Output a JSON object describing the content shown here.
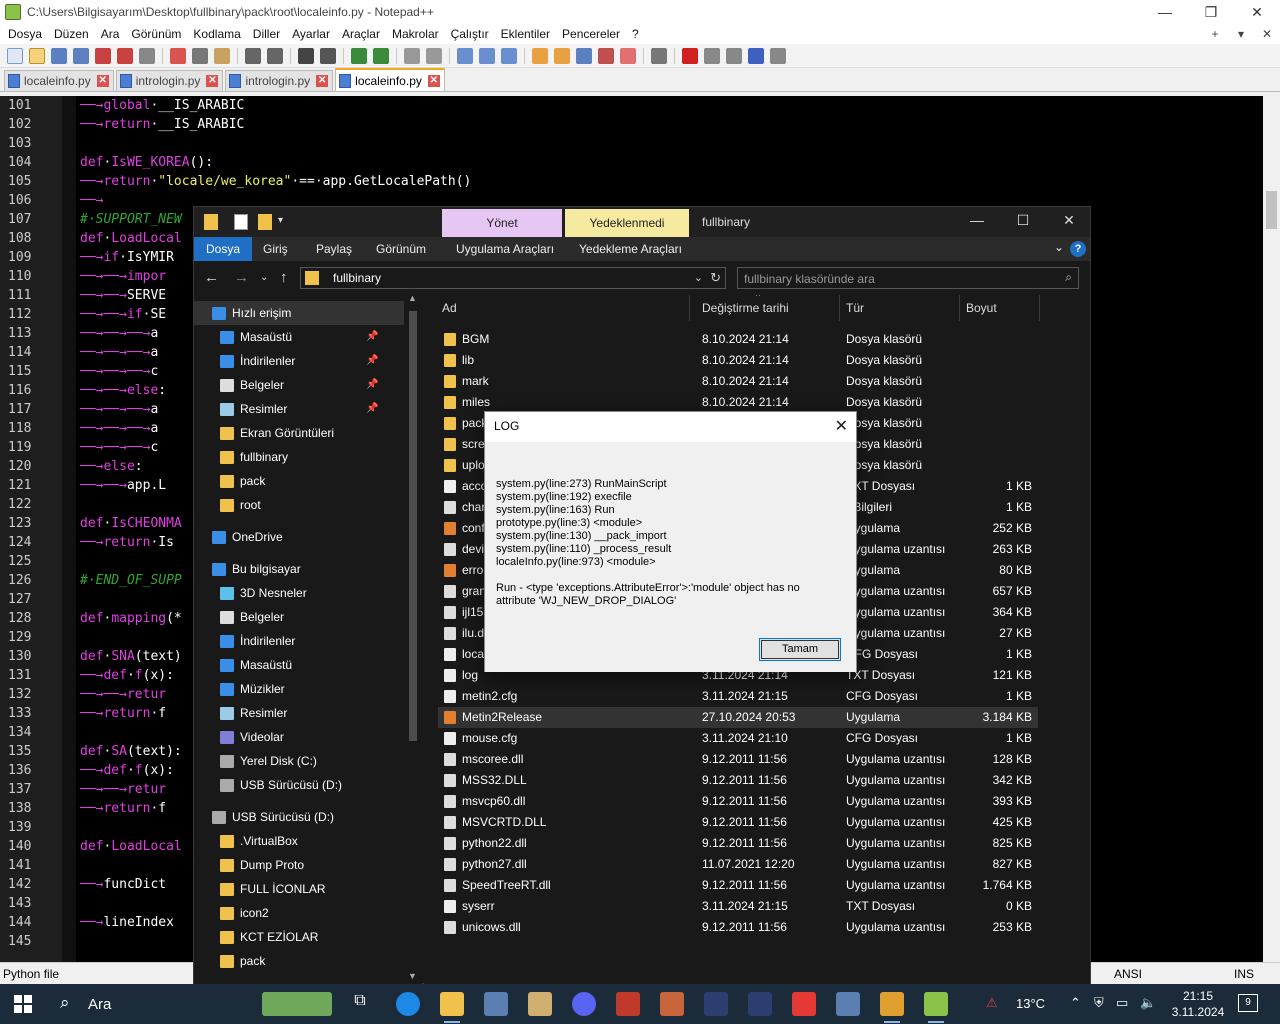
{
  "npp": {
    "title": "C:\\Users\\Bilgisayarım\\Desktop\\fullbinary\\pack\\root\\localeinfo.py - Notepad++",
    "menu": [
      "Dosya",
      "Düzen",
      "Ara",
      "Görünüm",
      "Kodlama",
      "Diller",
      "Ayarlar",
      "Araçlar",
      "Makrolar",
      "Çalıştır",
      "Eklentiler",
      "Pencereler",
      "?"
    ],
    "menu_right": [
      "+",
      "▾",
      "✕"
    ],
    "tabs": [
      {
        "label": "localeinfo.py"
      },
      {
        "label": "intrologin.py"
      },
      {
        "label": "intrologin.py"
      },
      {
        "label": "localeinfo.py"
      }
    ],
    "line_numbers": [
      "101",
      "102",
      "103",
      "104",
      "105",
      "106",
      "107",
      "108",
      "109",
      "110",
      "111",
      "112",
      "113",
      "114",
      "115",
      "116",
      "117",
      "118",
      "119",
      "120",
      "121",
      "122",
      "123",
      "124",
      "125",
      "126",
      "127",
      "128",
      "129",
      "130",
      "131",
      "132",
      "133",
      "134",
      "135",
      "136",
      "137",
      "138",
      "139",
      "140",
      "141",
      "142",
      "143",
      "144",
      "145"
    ],
    "status": {
      "lang": "Python file",
      "eol": "",
      "encoding": "ANSI",
      "mode": "INS"
    }
  },
  "explorer": {
    "title": "fullbinary",
    "tab_manage": "Yönet",
    "tab_bin": "Yedeklenmedi",
    "ribbon": [
      "Dosya",
      "Giriş",
      "Paylaş",
      "Görünüm",
      "Uygulama Araçları",
      "Yedekleme Araçları"
    ],
    "address": "fullbinary",
    "search_placeholder": "fullbinary klasöründe ara",
    "nav": [
      {
        "label": "Hızlı erişim",
        "icon": "star-icon"
      },
      {
        "label": "Masaüstü",
        "icon": "desktop-icon"
      },
      {
        "label": "İndirilenler",
        "icon": "download-icon"
      },
      {
        "label": "Belgeler",
        "icon": "documents-icon"
      },
      {
        "label": "Resimler",
        "icon": "pictures-icon"
      },
      {
        "label": "Ekran Görüntüleri",
        "icon": "folder-icon"
      },
      {
        "label": "fullbinary",
        "icon": "folder-icon"
      },
      {
        "label": "pack",
        "icon": "folder-icon"
      },
      {
        "label": "root",
        "icon": "folder-icon"
      },
      {
        "label": "OneDrive",
        "icon": "cloud-icon"
      },
      {
        "label": "Bu bilgisayar",
        "icon": "computer-icon"
      },
      {
        "label": "3D Nesneler",
        "icon": "cube-icon"
      },
      {
        "label": "Belgeler",
        "icon": "documents-icon"
      },
      {
        "label": "İndirilenler",
        "icon": "download-icon"
      },
      {
        "label": "Masaüstü",
        "icon": "desktop-icon"
      },
      {
        "label": "Müzikler",
        "icon": "music-icon"
      },
      {
        "label": "Resimler",
        "icon": "pictures-icon"
      },
      {
        "label": "Videolar",
        "icon": "video-icon"
      },
      {
        "label": "Yerel Disk (C:)",
        "icon": "drive-icon"
      },
      {
        "label": "USB Sürücüsü (D:)",
        "icon": "usb-drive-icon"
      },
      {
        "label": "USB Sürücüsü (D:)",
        "icon": "usb-drive-icon"
      },
      {
        "label": ".VirtualBox",
        "icon": "folder-icon"
      },
      {
        "label": "Dump Proto",
        "icon": "folder-icon"
      },
      {
        "label": "FULL İCONLAR",
        "icon": "folder-icon"
      },
      {
        "label": "icon2",
        "icon": "folder-icon"
      },
      {
        "label": "KCT EZİOLAR",
        "icon": "folder-icon"
      },
      {
        "label": "pack",
        "icon": "folder-icon"
      }
    ],
    "columns": [
      "Ad",
      "Değiştirme tarihi",
      "Tür",
      "Boyut"
    ],
    "files": [
      {
        "name": "BGM",
        "date": "8.10.2024 21:14",
        "type": "Dosya klasörü",
        "size": ""
      },
      {
        "name": "lib",
        "date": "8.10.2024 21:14",
        "type": "Dosya klasörü",
        "size": ""
      },
      {
        "name": "mark",
        "date": "8.10.2024 21:14",
        "type": "Dosya klasörü",
        "size": ""
      },
      {
        "name": "miles",
        "date": "8.10.2024 21:14",
        "type": "Dosya klasörü",
        "size": ""
      },
      {
        "name": "pack",
        "date": "",
        "type": "Dosya klasörü",
        "size": ""
      },
      {
        "name": "screenshot",
        "date": "",
        "type": "Dosya klasörü",
        "size": ""
      },
      {
        "name": "upload",
        "date": "",
        "type": "Dosya klasörü",
        "size": ""
      },
      {
        "name": "account",
        "date": "",
        "type": "TXT Dosyası",
        "size": "1 KB"
      },
      {
        "name": "channel",
        "date": "",
        "type": "r Bilgileri",
        "size": "1 KB"
      },
      {
        "name": "config",
        "date": "",
        "type": "Uygulama",
        "size": "252 KB"
      },
      {
        "name": "devil",
        "date": "",
        "type": "Uygulama uzantısı",
        "size": "263 KB"
      },
      {
        "name": "error",
        "date": "",
        "type": "Uygulama",
        "size": "80 KB"
      },
      {
        "name": "granny2",
        "date": "",
        "type": "Uygulama uzantısı",
        "size": "657 KB"
      },
      {
        "name": "ijl15",
        "date": "",
        "type": "Uygulama uzantısı",
        "size": "364 KB"
      },
      {
        "name": "ilu.dll",
        "date": "",
        "type": "Uygulama uzantısı",
        "size": "27 KB"
      },
      {
        "name": "locale",
        "date": "",
        "type": "CFG Dosyası",
        "size": "1 KB"
      },
      {
        "name": "log",
        "date": "3.11.2024 21:14",
        "type": "TXT Dosyası",
        "size": "121 KB"
      },
      {
        "name": "metin2.cfg",
        "date": "3.11.2024 21:15",
        "type": "CFG Dosyası",
        "size": "1 KB"
      },
      {
        "name": "Metin2Release",
        "date": "27.10.2024 20:53",
        "type": "Uygulama",
        "size": "3.184 KB"
      },
      {
        "name": "mouse.cfg",
        "date": "3.11.2024 21:10",
        "type": "CFG Dosyası",
        "size": "1 KB"
      },
      {
        "name": "mscoree.dll",
        "date": "9.12.2011 11:56",
        "type": "Uygulama uzantısı",
        "size": "128 KB"
      },
      {
        "name": "MSS32.DLL",
        "date": "9.12.2011 11:56",
        "type": "Uygulama uzantısı",
        "size": "342 KB"
      },
      {
        "name": "msvcp60.dll",
        "date": "9.12.2011 11:56",
        "type": "Uygulama uzantısı",
        "size": "393 KB"
      },
      {
        "name": "MSVCRTD.DLL",
        "date": "9.12.2011 11:56",
        "type": "Uygulama uzantısı",
        "size": "425 KB"
      },
      {
        "name": "python22.dll",
        "date": "9.12.2011 11:56",
        "type": "Uygulama uzantısı",
        "size": "825 KB"
      },
      {
        "name": "python27.dll",
        "date": "11.07.2021 12:20",
        "type": "Uygulama uzantısı",
        "size": "827 KB"
      },
      {
        "name": "SpeedTreeRT.dll",
        "date": "9.12.2011 11:56",
        "type": "Uygulama uzantısı",
        "size": "1.764 KB"
      },
      {
        "name": "syserr",
        "date": "3.11.2024 21:15",
        "type": "TXT Dosyası",
        "size": "0 KB"
      },
      {
        "name": "unicows.dll",
        "date": "9.12.2011 11:56",
        "type": "Uygulama uzantısı",
        "size": "253 KB"
      }
    ]
  },
  "log_dialog": {
    "title": "LOG",
    "lines": [
      "system.py(line:273) RunMainScript",
      "system.py(line:192) execfile",
      "system.py(line:163) Run",
      "prototype.py(line:3) <module>",
      "system.py(line:130) __pack_import",
      "system.py(line:110) _process_result",
      "localeInfo.py(line:973) <module>",
      "",
      "Run - <type 'exceptions.AttributeError'>:'module' object has no",
      "attribute 'WJ_NEW_DROP_DIALOG'"
    ],
    "ok_label": "Tamam"
  },
  "taskbar": {
    "search_label": "Ara",
    "temperature": "13°C",
    "time": "21:15",
    "date": "3.11.2024",
    "notifications": "9"
  }
}
